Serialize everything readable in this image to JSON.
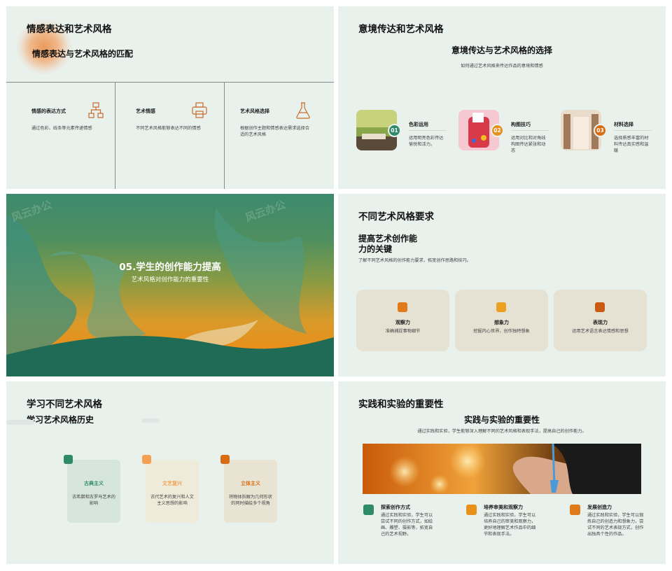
{
  "colors": {
    "green": "#2f8a6a",
    "orange": "#e8901c",
    "deep_orange": "#d86c12",
    "bg": "#e9f1ed",
    "card": "#e6e2d3"
  },
  "slide1": {
    "title": "情感表达和艺术风格",
    "subtitle": "情感表达与艺术风格的匹配",
    "cols": [
      {
        "label": "情感的表达方式",
        "desc": "通过色彩、线条等元素传递情感",
        "icon": "hierarchy-icon"
      },
      {
        "label": "艺术情感",
        "desc": "不同艺术风格能够表达不同的情感",
        "icon": "printer-icon"
      },
      {
        "label": "艺术风格选择",
        "desc": "根据创作主题和情感表达需求选择合适的艺术风格",
        "icon": "flask-icon"
      }
    ]
  },
  "slide2": {
    "title": "意境传达和艺术风格",
    "heading": "意境传达与艺术风格的选择",
    "desc": "如何通过艺术风格来传达作品的意境和情感",
    "items": [
      {
        "num": "01",
        "label": "色彩运用",
        "desc": "运用明亮色彩传达愉悦和活力。"
      },
      {
        "num": "02",
        "label": "构图技巧",
        "desc": "运用对比和对角线构图传达紧张和动态"
      },
      {
        "num": "03",
        "label": "材料选择",
        "desc": "选择质感丰富的材料传达真实感和温暖"
      }
    ]
  },
  "slide3": {
    "title": "05.学生的创作能力提高",
    "subtitle": "艺术风格对创作能力的重要性",
    "watermark": "风云办公"
  },
  "slide4": {
    "title": "不同艺术风格要求",
    "heading_line1": "提高艺术创作能",
    "heading_line2": "力的关键",
    "desc": "了解不同艺术风格的创作能力要求，拓宽创作思路和技巧。",
    "cards": [
      {
        "label": "观察力",
        "desc": "准确捕捉事物细节"
      },
      {
        "label": "想象力",
        "desc": "挖掘内心世界，创作独特想象"
      },
      {
        "label": "表现力",
        "desc": "运用艺术语言表达情感和思想"
      }
    ]
  },
  "slide5": {
    "title": "学习不同艺术风格",
    "subtitle": "学习艺术风格历史",
    "cards": [
      {
        "label": "古典主义",
        "desc": "古希腊和古罗马艺术的影响"
      },
      {
        "label": "文艺复兴",
        "desc": "古代艺术的复兴和人文主义思想的影响"
      },
      {
        "label": "立体主义",
        "desc": "将物体拆解为几何形状的同时描绘多个视角"
      }
    ]
  },
  "slide6": {
    "title": "实践和实验的重要性",
    "heading": "实践与实验的重要性",
    "desc": "通过实践和实验，学生能够深入理解不同的艺术风格和表现手法，提高自己的创作能力。",
    "items": [
      {
        "label": "探索创作方式",
        "desc": "通过实践和实验，学生可以尝试不同的创作方式，如绘画、雕塑、摄影等，拓宽自己的艺术视野。"
      },
      {
        "label": "培养审美和观察力",
        "desc": "通过实践和实验，学生可以培养自己的审美和观察力，更好地理解艺术作品中的细节和表现手法。"
      },
      {
        "label": "发展创造力",
        "desc": "通过实践和实验，学生可以锻炼自己的创造力和想象力，尝试不同的艺术表现方式，创作出独具个性的作品。"
      }
    ]
  }
}
